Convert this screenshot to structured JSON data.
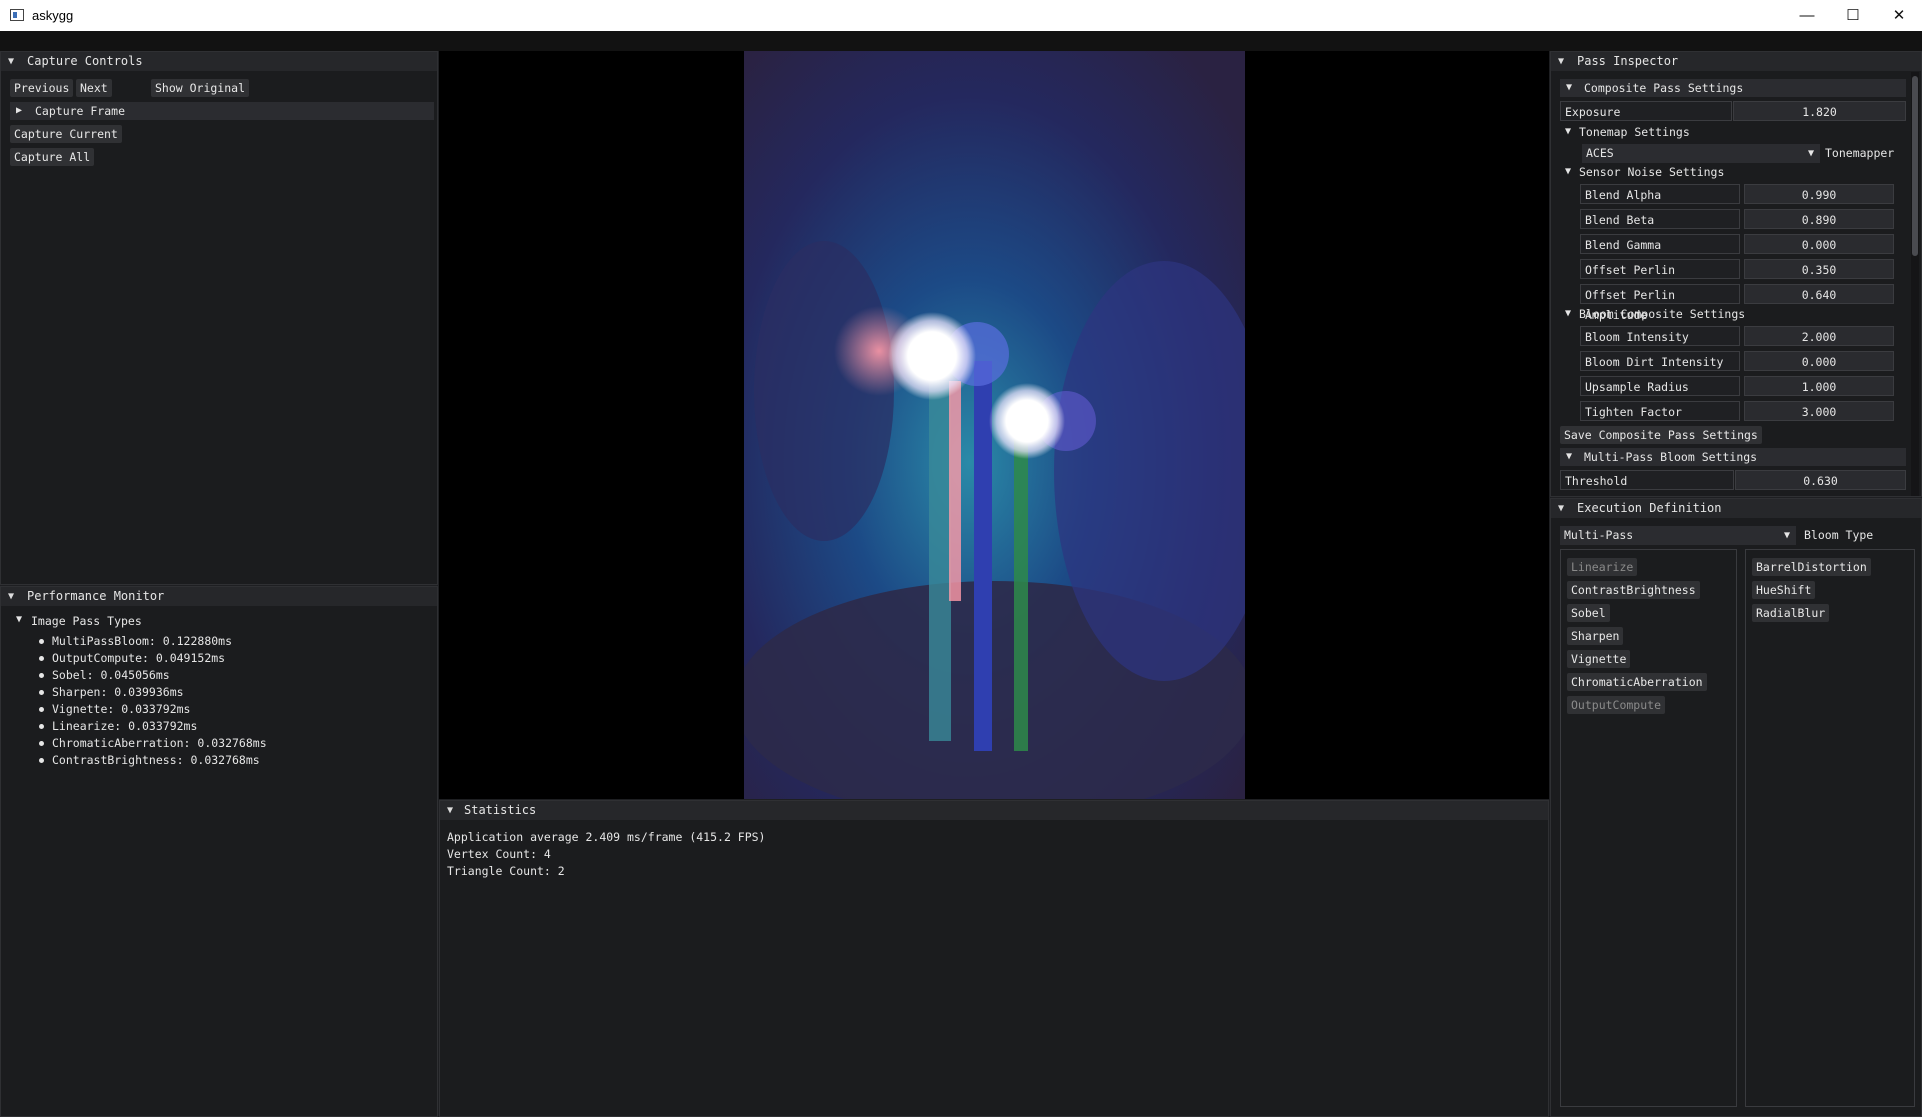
{
  "window": {
    "title": "askygg",
    "minimize": "—",
    "maximize": "☐",
    "close": "✕"
  },
  "capture_controls": {
    "title": "Capture Controls",
    "previous": "Previous",
    "next": "Next",
    "show_original": "Show Original",
    "capture_frame": "Capture Frame",
    "capture_current": "Capture Current",
    "capture_all": "Capture All"
  },
  "performance": {
    "title": "Performance Monitor",
    "group": "Image Pass Types",
    "items": [
      "MultiPassBloom: 0.122880ms",
      "OutputCompute: 0.049152ms",
      "Sobel: 0.045056ms",
      "Sharpen: 0.039936ms",
      "Vignette: 0.033792ms",
      "Linearize: 0.033792ms",
      "ChromaticAberration: 0.032768ms",
      "ContrastBrightness: 0.032768ms"
    ]
  },
  "statistics": {
    "title": "Statistics",
    "lines": [
      "Application average 2.409 ms/frame (415.2 FPS)",
      "Vertex Count: 4",
      "Triangle Count: 2"
    ]
  },
  "pass_inspector": {
    "title": "Pass Inspector",
    "composite_header": "Composite Pass Settings",
    "exposure_label": "Exposure",
    "exposure_value": "1.820",
    "tonemap_header": "Tonemap Settings",
    "tonemapper_value": "ACES",
    "tonemapper_label": "Tonemapper",
    "sensor_header": "Sensor Noise Settings",
    "sensor": [
      {
        "label": "Blend Alpha",
        "value": "0.990"
      },
      {
        "label": "Blend Beta",
        "value": "0.890"
      },
      {
        "label": "Blend Gamma",
        "value": "0.000"
      },
      {
        "label": "Offset Perlin Frequency",
        "value": "0.350"
      },
      {
        "label": "Offset Perlin Amplitude",
        "value": "0.640"
      }
    ],
    "bloom_header": "Bloom Composite Settings",
    "bloom": [
      {
        "label": "Bloom Intensity",
        "value": "2.000"
      },
      {
        "label": "Bloom Dirt Intensity",
        "value": "0.000"
      },
      {
        "label": "Upsample Radius",
        "value": "1.000"
      },
      {
        "label": "Tighten Factor",
        "value": "3.000"
      }
    ],
    "save_button": "Save Composite Pass Settings",
    "multipass_header": "Multi-Pass Bloom Settings",
    "threshold_label": "Threshold",
    "threshold_value": "0.630"
  },
  "execution": {
    "title": "Execution Definition",
    "bloom_type_value": "Multi-Pass",
    "bloom_type_label": "Bloom Type",
    "left_list": [
      {
        "label": "Linearize",
        "enabled": false
      },
      {
        "label": "ContrastBrightness",
        "enabled": true
      },
      {
        "label": "Sobel",
        "enabled": true
      },
      {
        "label": "Sharpen",
        "enabled": true
      },
      {
        "label": "Vignette",
        "enabled": true
      },
      {
        "label": "ChromaticAberration",
        "enabled": true
      },
      {
        "label": "OutputCompute",
        "enabled": false
      }
    ],
    "right_list": [
      "BarrelDistortion",
      "HueShift",
      "RadialBlur"
    ]
  },
  "colors": {
    "accent_panel": "#26272a",
    "viewport_bg": "#000000"
  }
}
